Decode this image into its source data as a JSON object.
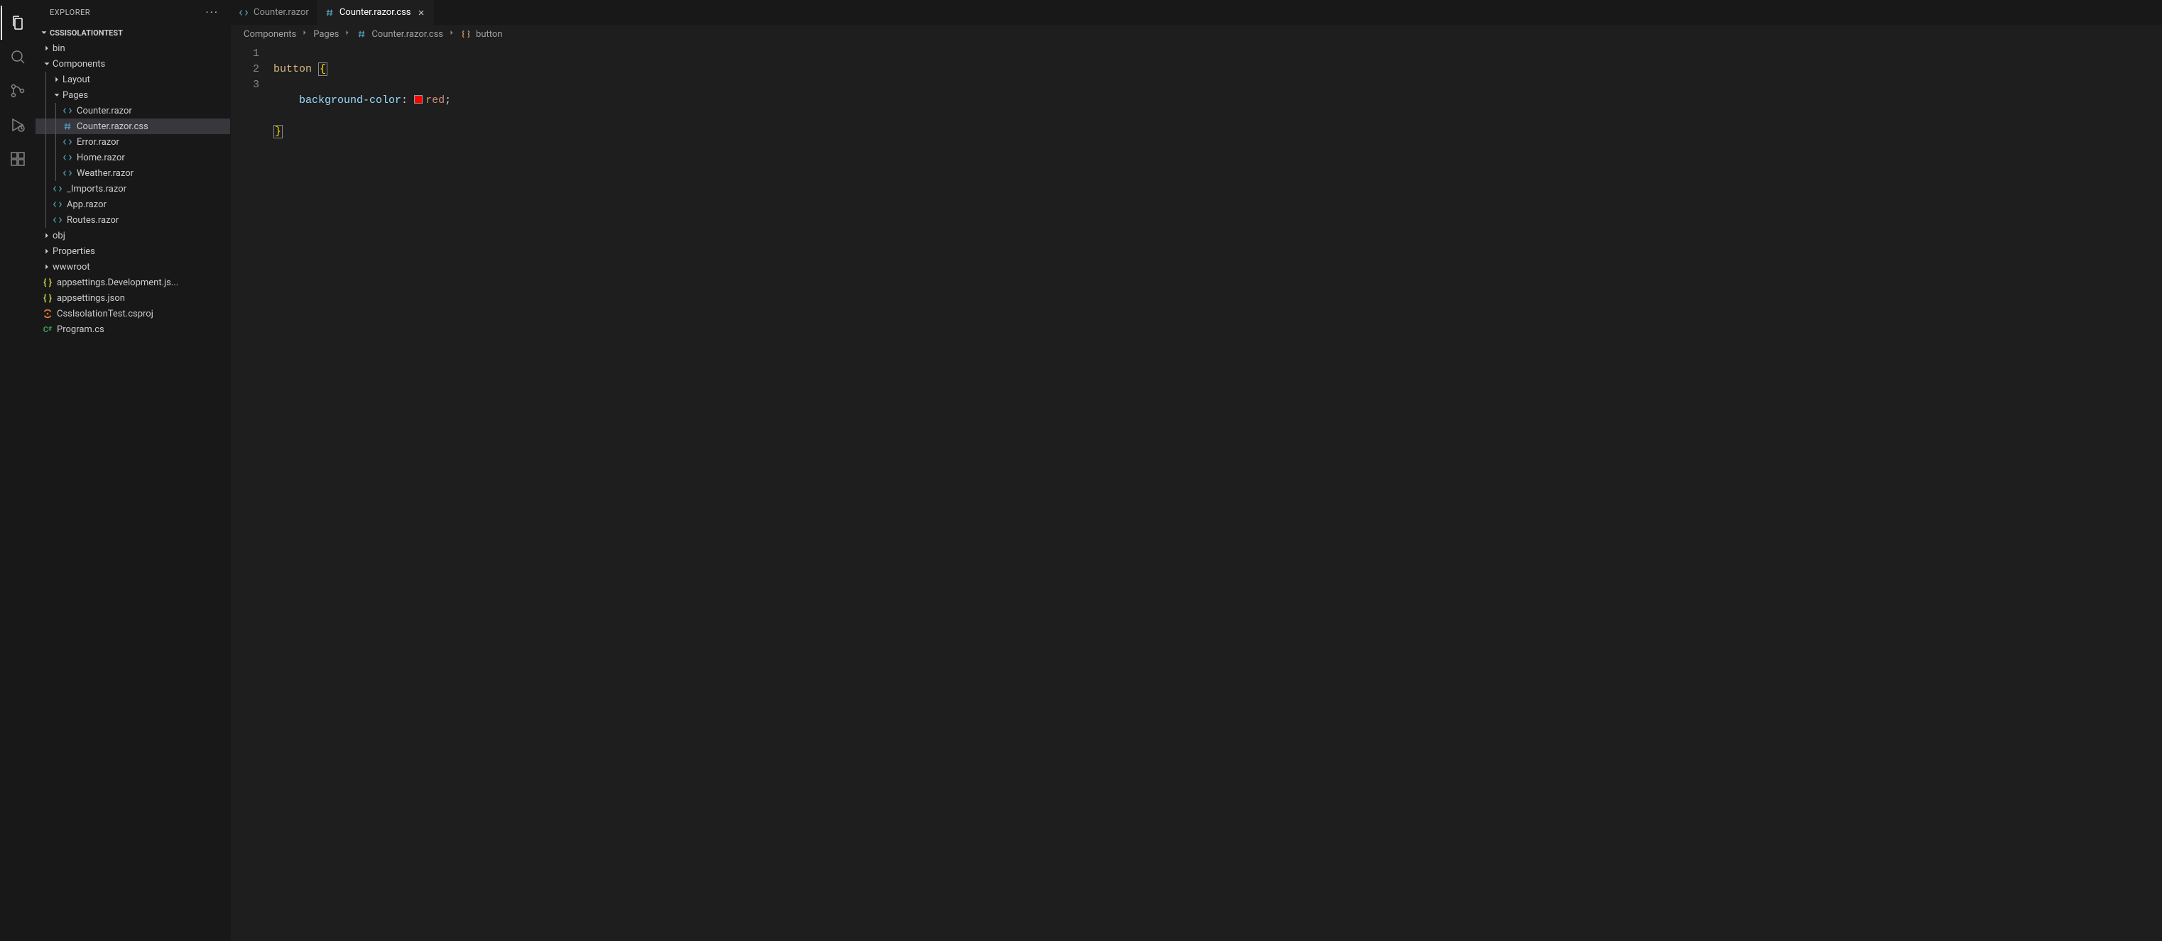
{
  "activity_bar": {
    "items": [
      {
        "name": "explorer",
        "active": true
      },
      {
        "name": "search",
        "active": false
      },
      {
        "name": "source-control",
        "active": false
      },
      {
        "name": "run-debug",
        "active": false
      },
      {
        "name": "extensions",
        "active": false
      }
    ]
  },
  "sidebar": {
    "title": "EXPLORER",
    "project_name": "CSSISOLATIONTEST",
    "tree": [
      {
        "depth": 0,
        "kind": "folder",
        "expanded": false,
        "label": "bin"
      },
      {
        "depth": 0,
        "kind": "folder",
        "expanded": true,
        "label": "Components"
      },
      {
        "depth": 1,
        "kind": "folder",
        "expanded": false,
        "label": "Layout"
      },
      {
        "depth": 1,
        "kind": "folder",
        "expanded": true,
        "label": "Pages"
      },
      {
        "depth": 2,
        "kind": "file",
        "icon": "code",
        "label": "Counter.razor"
      },
      {
        "depth": 2,
        "kind": "file",
        "icon": "hash",
        "label": "Counter.razor.css",
        "active": true
      },
      {
        "depth": 2,
        "kind": "file",
        "icon": "code",
        "label": "Error.razor"
      },
      {
        "depth": 2,
        "kind": "file",
        "icon": "code",
        "label": "Home.razor"
      },
      {
        "depth": 2,
        "kind": "file",
        "icon": "code",
        "label": "Weather.razor"
      },
      {
        "depth": 1,
        "kind": "file",
        "icon": "code",
        "label": "_Imports.razor"
      },
      {
        "depth": 1,
        "kind": "file",
        "icon": "code",
        "label": "App.razor"
      },
      {
        "depth": 1,
        "kind": "file",
        "icon": "code",
        "label": "Routes.razor"
      },
      {
        "depth": 0,
        "kind": "folder",
        "expanded": false,
        "label": "obj"
      },
      {
        "depth": 0,
        "kind": "folder",
        "expanded": false,
        "label": "Properties"
      },
      {
        "depth": 0,
        "kind": "folder",
        "expanded": false,
        "label": "wwwroot"
      },
      {
        "depth": 0,
        "kind": "file",
        "icon": "json",
        "label": "appsettings.Development.js..."
      },
      {
        "depth": 0,
        "kind": "file",
        "icon": "json",
        "label": "appsettings.json"
      },
      {
        "depth": 0,
        "kind": "file",
        "icon": "csproj",
        "label": "CssIsolationTest.csproj"
      },
      {
        "depth": 0,
        "kind": "file",
        "icon": "cs",
        "label": "Program.cs"
      }
    ]
  },
  "tabs": [
    {
      "label": "Counter.razor",
      "icon": "code",
      "active": false,
      "closeable": false
    },
    {
      "label": "Counter.razor.css",
      "icon": "hash",
      "active": true,
      "closeable": true
    }
  ],
  "breadcrumbs": [
    {
      "label": "Components",
      "icon": null
    },
    {
      "label": "Pages",
      "icon": null
    },
    {
      "label": "Counter.razor.css",
      "icon": "hash"
    },
    {
      "label": "button",
      "icon": "symbol"
    }
  ],
  "editor": {
    "line_numbers": [
      "1",
      "2",
      "3"
    ],
    "tokens": {
      "l1_selector": "button",
      "l1_brace": "{",
      "l2_indent": "    ",
      "l2_prop": "background-color",
      "l2_colon": ":",
      "l2_value": "red",
      "l2_semi": ";",
      "l3_brace": "}"
    },
    "swatch_color": "#ff0000"
  }
}
